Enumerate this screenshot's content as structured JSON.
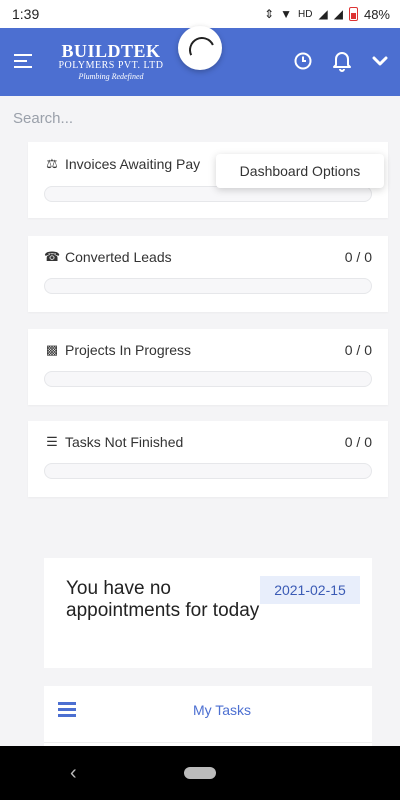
{
  "status_bar": {
    "time": "1:39",
    "network": "HD",
    "battery": "48%"
  },
  "header": {
    "logo_main": "BUILDTEK",
    "logo_sub": "POLYMERS PVT. LTD",
    "logo_tagline": "Plumbing Redefined",
    "icons": [
      "menu-icon",
      "history-icon",
      "bell-icon",
      "chevron-down-icon"
    ],
    "accent_color": "#4c6fd1"
  },
  "search": {
    "placeholder": "Search..."
  },
  "dashboard_options_label": "Dashboard Options",
  "cards": [
    {
      "title": "Invoices Awaiting Pay",
      "icon": "balance-scale-icon",
      "count": ""
    },
    {
      "title": "Converted Leads",
      "icon": "phone-icon",
      "count": "0 / 0"
    },
    {
      "title": "Projects In Progress",
      "icon": "cubes-icon",
      "count": "0 / 0"
    },
    {
      "title": "Tasks Not Finished",
      "icon": "tasks-icon",
      "count": "0 / 0"
    }
  ],
  "appointments": {
    "message": "You have no appointments for today",
    "date": "2021-02-15"
  },
  "my_tasks": {
    "label": "My Tasks",
    "icon": "tasks-list-icon"
  }
}
